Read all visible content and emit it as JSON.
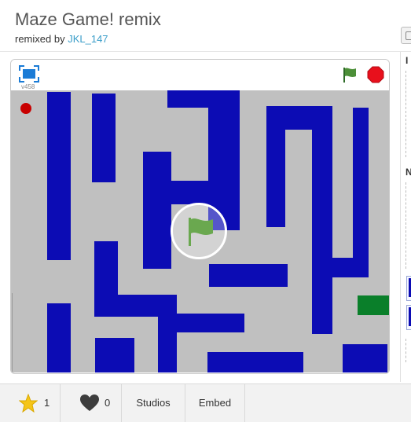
{
  "project": {
    "title": "Maze Game! remix",
    "remixed_prefix": "remixed by",
    "remixed_user": "JKL_147"
  },
  "player": {
    "version": "v458",
    "icons": {
      "fullscreen": "fullscreen-icon",
      "green_flag": "green-flag-icon",
      "stop": "stop-icon",
      "play_overlay": "green-flag-icon"
    },
    "colors": {
      "stage": "#c0c0c0",
      "wall": "#0c0cb4",
      "goal": "#0a7f2a",
      "player_dot": "#c80000"
    }
  },
  "side_panel": {
    "letters": [
      "I",
      "N"
    ]
  },
  "stats": {
    "favorites_count": "1",
    "loves_count": "0",
    "studios_label": "Studios",
    "embed_label": "Embed",
    "favorites_icon": "star-icon",
    "loves_icon": "heart-icon"
  }
}
